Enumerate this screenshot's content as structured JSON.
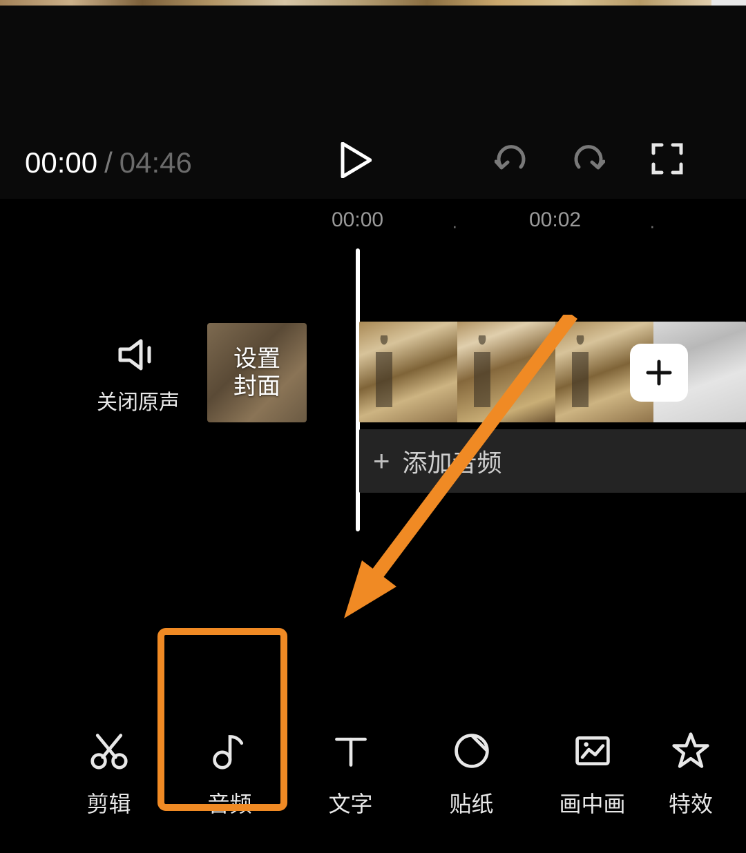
{
  "player": {
    "current_time": "00:00",
    "separator": "/",
    "total_time": "04:46"
  },
  "ruler": {
    "tick0": "00:00",
    "tick1": "00:02"
  },
  "mute_original_label": "关闭原声",
  "cover_set_label": "设置\n封面",
  "add_audio_label": "添加音频",
  "plus_symbol": "+",
  "toolbar": {
    "edit": "剪辑",
    "audio": "音频",
    "text": "文字",
    "sticker": "贴纸",
    "pip": "画中画",
    "effect": "特效"
  },
  "annotation": {
    "highlight_target": "audio"
  }
}
